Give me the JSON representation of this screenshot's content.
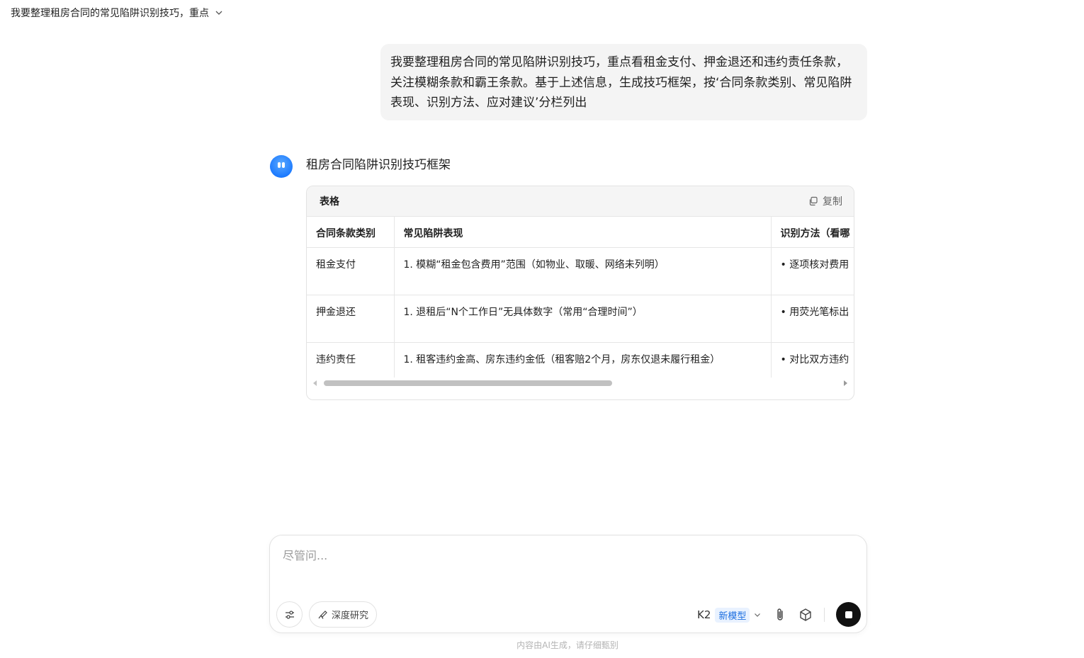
{
  "header": {
    "title": "我要整理租房合同的常见陷阱识别技巧，重点"
  },
  "user_message": {
    "text": "我要整理租房合同的常见陷阱识别技巧，重点看租金支付、押金退还和违约责任条款，关注模糊条款和霸王条款。基于上述信息，生成技巧框架，按‘合同条款类别、常见陷阱表现、识别方法、应对建议’分栏列出"
  },
  "assistant": {
    "title": "租房合同陷阱识别技巧框架",
    "table_card": {
      "label": "表格",
      "copy_label": "复制",
      "headers": [
        "合同条款类别",
        "常见陷阱表现",
        "识别方法（看哪"
      ],
      "rows": [
        [
          "租金支付",
          "1. 模糊“租金包含费用”范围（如物业、取暖、网络未列明）",
          "• 逐项核对费用"
        ],
        [
          "押金退还",
          "1. 退租后“N个工作日”无具体数字（常用“合理时间”）",
          "• 用荧光笔标出"
        ],
        [
          "违约责任",
          "1. 租客违约金高、房东违约金低（租客赔2个月，房东仅退未履行租金）",
          "• 对比双方违约"
        ]
      ]
    }
  },
  "composer": {
    "placeholder": "尽管问...",
    "deep_research_label": "深度研究",
    "model_name": "K2",
    "model_badge": "新模型"
  },
  "footer": {
    "note": "内容由AI生成，请仔细甄别"
  },
  "icons": {
    "avatar": "kimi-avatar-icon",
    "chevron": "chevron-down-icon",
    "copy": "copy-icon",
    "tools": "sliders-icon",
    "deep_research": "telescope-icon",
    "attach": "paperclip-icon",
    "cube": "cube-icon",
    "stop": "stop-icon"
  },
  "colors": {
    "accent": "#1d7bff",
    "badge_text": "#1d6fe0",
    "badge_bg": "#e9f2ff",
    "bubble_bg": "#f4f4f4",
    "stop_button": "#111111"
  }
}
